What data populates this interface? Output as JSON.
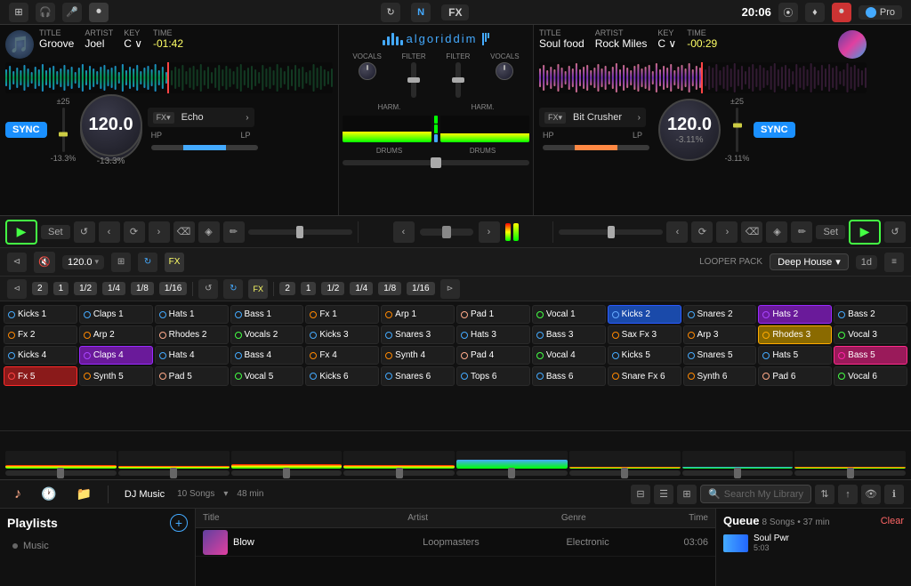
{
  "topbar": {
    "time": "20:06",
    "pro_label": "Pro",
    "fx_label": "FX"
  },
  "deck_left": {
    "title_label": "TITLE",
    "title": "Groove",
    "artist_label": "ARTIST",
    "artist": "Joel",
    "key_label": "KEY",
    "key": "C ∨",
    "time_label": "TIME",
    "time": "-01:42",
    "bpm_range": "±25",
    "bpm": "120.0",
    "pitch": "-13.3%",
    "sync": "SYNC",
    "fx_name": "Echo",
    "hp": "HP",
    "lp": "LP"
  },
  "deck_right": {
    "title_label": "TITLE",
    "title": "Soul food",
    "artist_label": "ARTIST",
    "artist": "Rock Miles",
    "key_label": "KEY",
    "key": "C ∨",
    "time_label": "TIME",
    "time": "-00:29",
    "bpm_range": "±25",
    "bpm": "120.0",
    "pitch": "-3.11%",
    "sync": "SYNC",
    "fx_name": "Bit Crusher",
    "hp": "HP",
    "lp": "LP"
  },
  "beat_toolbar": {
    "bpm_value": "120.0",
    "looper_pack_label": "LOOPER PACK",
    "looper_pack": "Deep House",
    "quantize": "1d"
  },
  "subdivisions": {
    "deck1": [
      "2",
      "1",
      "1/2",
      "1/4",
      "1/8",
      "1/16"
    ],
    "deck2": [
      "2",
      "1",
      "1/2",
      "1/4",
      "1/8",
      "1/16"
    ]
  },
  "pads": {
    "col1": [
      "Kicks 1",
      "Kicks 2",
      "Kicks 3",
      "Kicks 4",
      "Kicks 5",
      "Kicks 6"
    ],
    "col2": [
      "Claps 1",
      "Snares 2",
      "Snares 3",
      "Claps 4",
      "Snares 5",
      "Snares 6"
    ],
    "col3": [
      "Hats 1",
      "Hats 2",
      "Hats 3",
      "Hats 4",
      "Hats 5",
      "Tops 6"
    ],
    "col4": [
      "Bass 1",
      "Bass 2",
      "Bass 3",
      "Bass 4",
      "Bass 5",
      "Bass 6"
    ],
    "col5": [
      "Fx 1",
      "Fx 2",
      "Sax Fx 3",
      "Fx 4",
      "Fx 5",
      "Snare Fx 6"
    ],
    "col6": [
      "Arp 1",
      "Arp 2",
      "Arp 3",
      "Synth 4",
      "Synth 5",
      "Synth 6"
    ],
    "col7": [
      "Pad 1",
      "Rhodes 2",
      "Rhodes 3",
      "Pad 4",
      "Pad 5",
      "Pad 6"
    ],
    "col8": [
      "Vocal 1",
      "Vocals 2",
      "Vocal 3",
      "Vocal 4",
      "Vocal 5",
      "Vocal 6"
    ]
  },
  "library": {
    "tabs": [
      "music-note",
      "clock",
      "folder"
    ],
    "collection": "DJ Music",
    "songs_count": "10 Songs",
    "duration": "48 min",
    "search_placeholder": "Search My Library",
    "columns": [
      "Title",
      "Artist",
      "Genre",
      "Time"
    ],
    "tracks": [
      {
        "thumb": true,
        "title": "Blow",
        "artist": "Loopmasters",
        "genre": "Electronic",
        "time": "03:06"
      }
    ]
  },
  "sidebar": {
    "title": "Playlists",
    "add_label": "+",
    "items": [
      {
        "label": "Music",
        "selected": false
      }
    ]
  },
  "queue": {
    "title": "Queue",
    "count": "8 Songs",
    "duration": "37 min",
    "clear": "Clear",
    "tracks": [
      {
        "title": "Soul Pwr",
        "time": "5:03"
      }
    ]
  }
}
